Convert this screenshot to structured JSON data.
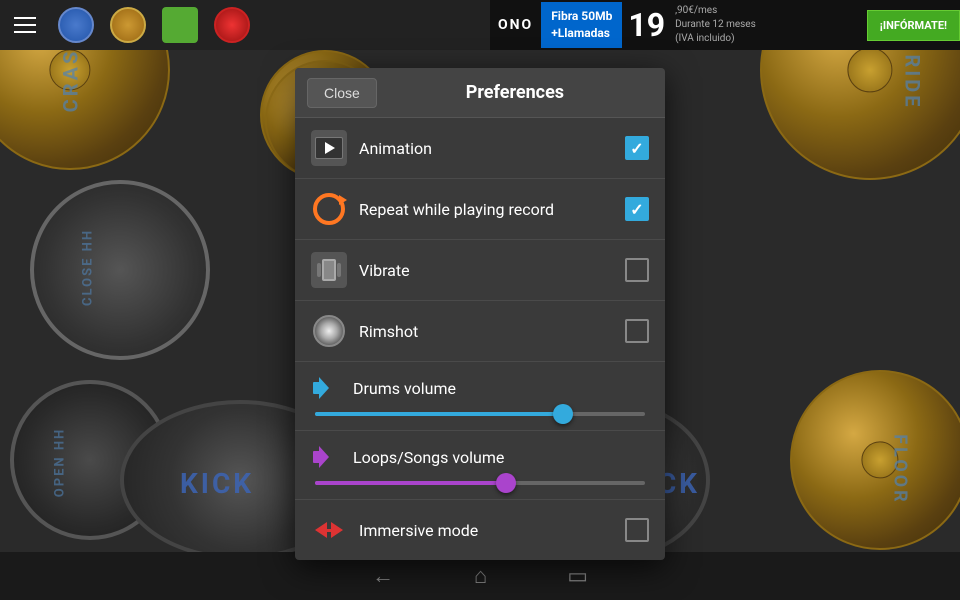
{
  "toolbar": {
    "hamburger_label": "Menu"
  },
  "ad": {
    "logo": "ONO",
    "text1_line1": "Fibra 50Mb",
    "text1_line2": "+Llamadas",
    "price": "19",
    "price_decimal": ",90€/mes",
    "price_detail_line1": "Durante 12 meses",
    "price_detail_line2": "(IVA incluido)",
    "cta": "¡INFÓRMATE!"
  },
  "preferences": {
    "title": "Preferences",
    "close_label": "Close",
    "items": [
      {
        "id": "animation",
        "label": "Animation",
        "icon": "animation-icon",
        "checked": true
      },
      {
        "id": "repeat",
        "label": "Repeat while playing record",
        "icon": "repeat-icon",
        "checked": true
      },
      {
        "id": "vibrate",
        "label": "Vibrate",
        "icon": "vibrate-icon",
        "checked": false
      },
      {
        "id": "rimshot",
        "label": "Rimshot",
        "icon": "rimshot-icon",
        "checked": false
      }
    ],
    "sliders": [
      {
        "id": "drums-volume",
        "label": "Drums volume",
        "icon": "blue-volume-icon",
        "value": 75,
        "color": "#33aadd"
      },
      {
        "id": "loops-volume",
        "label": "Loops/Songs volume",
        "icon": "purple-volume-icon",
        "value": 58,
        "color": "#aa44cc"
      }
    ],
    "immersive": {
      "label": "Immersive mode",
      "checked": false
    }
  },
  "nav": {
    "back": "←",
    "home": "⌂",
    "recents": "▭"
  },
  "drum_labels": {
    "crash": "CRASH",
    "ride": "RIDE",
    "close_hh": "CLOSE HH",
    "open_hh": "OPEN HH",
    "kick": "KICK",
    "kick2": "KICK",
    "floor": "FLOOR"
  }
}
